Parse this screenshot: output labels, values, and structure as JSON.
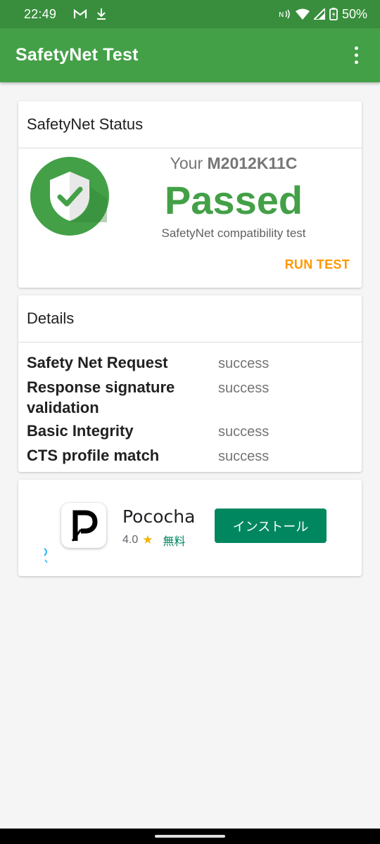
{
  "status_bar": {
    "time": "22:49",
    "battery": "50%",
    "icons": [
      "gmail-icon",
      "download-icon",
      "nfc-icon",
      "wifi-icon",
      "signal-icon",
      "battery-icon"
    ]
  },
  "app_bar": {
    "title": "SafetyNet Test",
    "menu_icon": "overflow-menu-icon"
  },
  "status_card": {
    "header": "SafetyNet Status",
    "device_prefix": "Your",
    "device_model": "M2012K11C",
    "result": "Passed",
    "subtitle": "SafetyNet compatibility test",
    "action": "RUN TEST",
    "icon": "shield-check-icon"
  },
  "details_card": {
    "header": "Details",
    "rows": [
      {
        "key": "Safety Net Request",
        "value": "success"
      },
      {
        "key": "Response signature validation",
        "value": "success"
      },
      {
        "key": "Basic Integrity",
        "value": "success"
      },
      {
        "key": "CTS profile match",
        "value": "success"
      }
    ]
  },
  "ad_card": {
    "app_name": "Pococha",
    "rating": "4.0",
    "price": "無料",
    "install_label": "インストール",
    "icon": "pococha-app-icon"
  },
  "colors": {
    "status_bar": "#388e3c",
    "app_bar": "#43a047",
    "passed": "#43a047",
    "accent": "#ff9800",
    "install": "#01875f"
  }
}
